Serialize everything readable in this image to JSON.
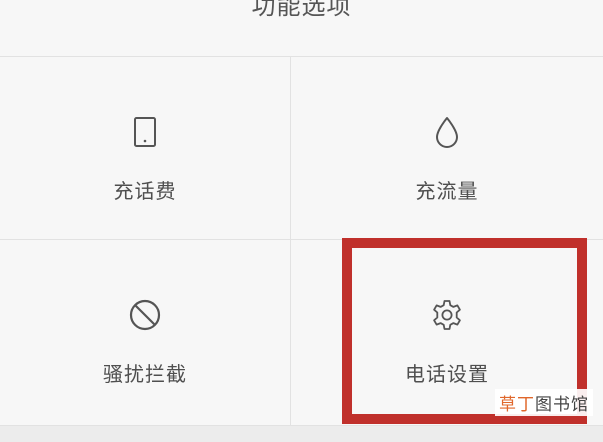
{
  "header": {
    "title": "功能选项"
  },
  "options": [
    {
      "label": "充话费",
      "icon": "tablet-icon"
    },
    {
      "label": "充流量",
      "icon": "droplet-icon"
    },
    {
      "label": "骚扰拦截",
      "icon": "block-icon"
    },
    {
      "label": "电话设置",
      "icon": "gear-icon"
    }
  ],
  "highlight": {
    "color": "#c0302b"
  },
  "watermark": {
    "part1": "草丁",
    "part2": "图书馆"
  }
}
